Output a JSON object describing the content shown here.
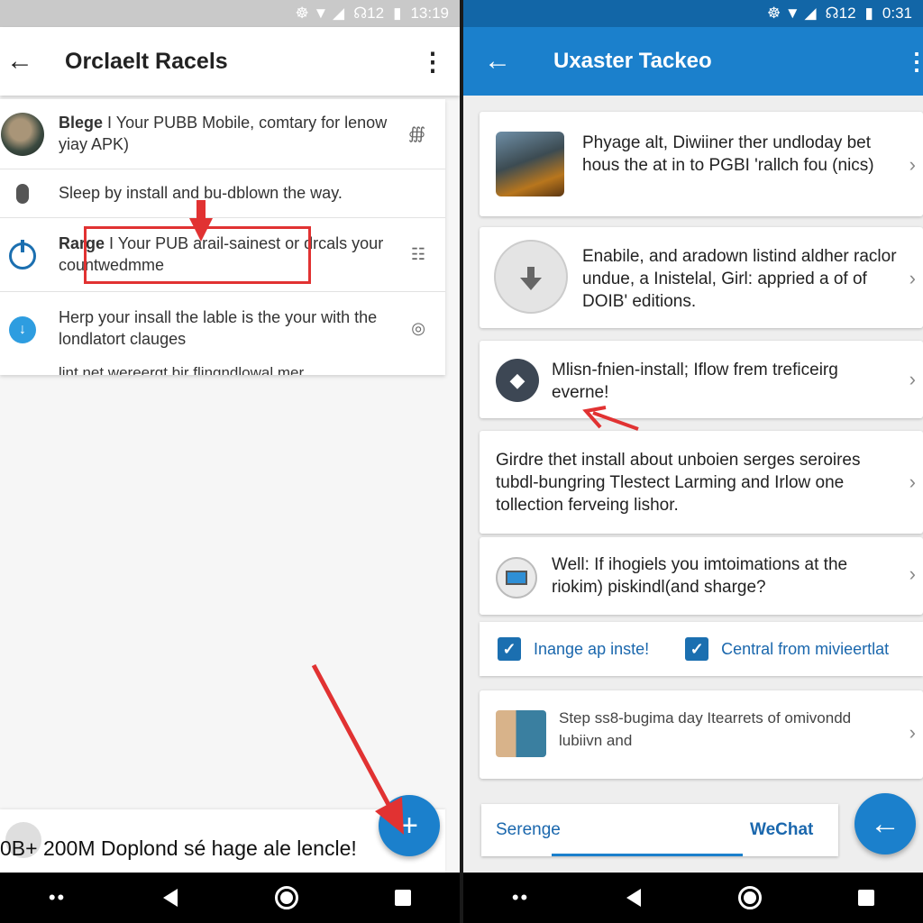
{
  "left": {
    "status": {
      "signal": "☸ ▼ ◢",
      "wifi": "☊12",
      "battery": "▮",
      "time": "13:19"
    },
    "appbar": {
      "title": "Orclaelt Racels"
    },
    "items": [
      {
        "bold": "Blege",
        "text": "I Your PUBB Mobile, comtary for lenow yiay APK)",
        "trail": "∰"
      },
      {
        "text": "Sleep by install and bu-dblown the way."
      },
      {
        "bold": "Rarge",
        "text": "I Your PUB arail-sainest or drcals your countwedmme",
        "trail": "☷"
      },
      {
        "text": "Herp your insall the lable is the your with the londlatort clauges",
        "trail": "◎"
      },
      {
        "text": "lint net wereergt bir flingndlowal mer"
      }
    ],
    "bottom_text": "0B+ 200M Doplond sé hage ale lencle!",
    "fab": "+"
  },
  "right": {
    "status": {
      "signal": "☸ ▼ ◢",
      "wifi": "☊12",
      "battery": "▮",
      "time": "0:31"
    },
    "appbar": {
      "title": "Uxaster Tackeo"
    },
    "cards": [
      {
        "text": "Phyage alt, Diwiiner ther undloday bet hous the at in to PGBI 'rallch fou (nics)"
      },
      {
        "text": "Enabile, and aradown listind aldher raclor undue, a Inistelal, Girl: appried a of of DOIB' editions."
      },
      {
        "text": "Mlisn-fnien-install; Iflow frem treficeirg everne!"
      },
      {
        "text": "Girdre thet install about unboien serges seroires tubdl-bungring Tlestect Larming and Irlow one tollection ferveing lishor."
      },
      {
        "text": "Well: If ihogiels you imtoimations at the riokim) piskindl(and sharge?"
      },
      {
        "text": "Step ss8-bugima day Itearrets of omivondd lubiivn and"
      }
    ],
    "checks": [
      {
        "label": "Inange ap inste!",
        "checked": true
      },
      {
        "label": "Central from mivieertlat",
        "checked": true
      }
    ],
    "tabs": {
      "tab1": "Serenge",
      "tab2": "WeChat"
    },
    "fab": "←"
  },
  "colors": {
    "primary": "#1b80cc",
    "annotation_red": "#e13232"
  },
  "icons": [
    "back-arrow-icon",
    "more-vert-icon",
    "mic-icon",
    "power-icon",
    "download-icon",
    "settings-icon",
    "checkbox-icon",
    "plus-icon"
  ]
}
